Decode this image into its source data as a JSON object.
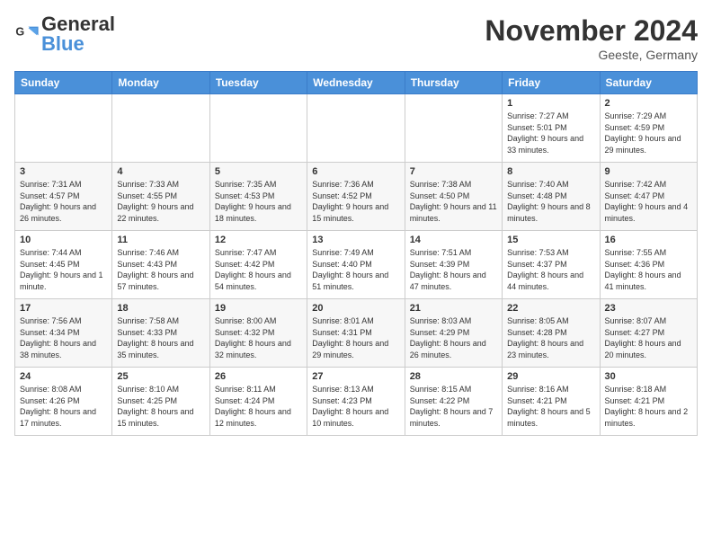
{
  "logo": {
    "text_general": "General",
    "text_blue": "Blue"
  },
  "header": {
    "month_year": "November 2024",
    "location": "Geeste, Germany"
  },
  "days_of_week": [
    "Sunday",
    "Monday",
    "Tuesday",
    "Wednesday",
    "Thursday",
    "Friday",
    "Saturday"
  ],
  "weeks": [
    [
      {
        "day": "",
        "info": ""
      },
      {
        "day": "",
        "info": ""
      },
      {
        "day": "",
        "info": ""
      },
      {
        "day": "",
        "info": ""
      },
      {
        "day": "",
        "info": ""
      },
      {
        "day": "1",
        "info": "Sunrise: 7:27 AM\nSunset: 5:01 PM\nDaylight: 9 hours and 33 minutes."
      },
      {
        "day": "2",
        "info": "Sunrise: 7:29 AM\nSunset: 4:59 PM\nDaylight: 9 hours and 29 minutes."
      }
    ],
    [
      {
        "day": "3",
        "info": "Sunrise: 7:31 AM\nSunset: 4:57 PM\nDaylight: 9 hours and 26 minutes."
      },
      {
        "day": "4",
        "info": "Sunrise: 7:33 AM\nSunset: 4:55 PM\nDaylight: 9 hours and 22 minutes."
      },
      {
        "day": "5",
        "info": "Sunrise: 7:35 AM\nSunset: 4:53 PM\nDaylight: 9 hours and 18 minutes."
      },
      {
        "day": "6",
        "info": "Sunrise: 7:36 AM\nSunset: 4:52 PM\nDaylight: 9 hours and 15 minutes."
      },
      {
        "day": "7",
        "info": "Sunrise: 7:38 AM\nSunset: 4:50 PM\nDaylight: 9 hours and 11 minutes."
      },
      {
        "day": "8",
        "info": "Sunrise: 7:40 AM\nSunset: 4:48 PM\nDaylight: 9 hours and 8 minutes."
      },
      {
        "day": "9",
        "info": "Sunrise: 7:42 AM\nSunset: 4:47 PM\nDaylight: 9 hours and 4 minutes."
      }
    ],
    [
      {
        "day": "10",
        "info": "Sunrise: 7:44 AM\nSunset: 4:45 PM\nDaylight: 9 hours and 1 minute."
      },
      {
        "day": "11",
        "info": "Sunrise: 7:46 AM\nSunset: 4:43 PM\nDaylight: 8 hours and 57 minutes."
      },
      {
        "day": "12",
        "info": "Sunrise: 7:47 AM\nSunset: 4:42 PM\nDaylight: 8 hours and 54 minutes."
      },
      {
        "day": "13",
        "info": "Sunrise: 7:49 AM\nSunset: 4:40 PM\nDaylight: 8 hours and 51 minutes."
      },
      {
        "day": "14",
        "info": "Sunrise: 7:51 AM\nSunset: 4:39 PM\nDaylight: 8 hours and 47 minutes."
      },
      {
        "day": "15",
        "info": "Sunrise: 7:53 AM\nSunset: 4:37 PM\nDaylight: 8 hours and 44 minutes."
      },
      {
        "day": "16",
        "info": "Sunrise: 7:55 AM\nSunset: 4:36 PM\nDaylight: 8 hours and 41 minutes."
      }
    ],
    [
      {
        "day": "17",
        "info": "Sunrise: 7:56 AM\nSunset: 4:34 PM\nDaylight: 8 hours and 38 minutes."
      },
      {
        "day": "18",
        "info": "Sunrise: 7:58 AM\nSunset: 4:33 PM\nDaylight: 8 hours and 35 minutes."
      },
      {
        "day": "19",
        "info": "Sunrise: 8:00 AM\nSunset: 4:32 PM\nDaylight: 8 hours and 32 minutes."
      },
      {
        "day": "20",
        "info": "Sunrise: 8:01 AM\nSunset: 4:31 PM\nDaylight: 8 hours and 29 minutes."
      },
      {
        "day": "21",
        "info": "Sunrise: 8:03 AM\nSunset: 4:29 PM\nDaylight: 8 hours and 26 minutes."
      },
      {
        "day": "22",
        "info": "Sunrise: 8:05 AM\nSunset: 4:28 PM\nDaylight: 8 hours and 23 minutes."
      },
      {
        "day": "23",
        "info": "Sunrise: 8:07 AM\nSunset: 4:27 PM\nDaylight: 8 hours and 20 minutes."
      }
    ],
    [
      {
        "day": "24",
        "info": "Sunrise: 8:08 AM\nSunset: 4:26 PM\nDaylight: 8 hours and 17 minutes."
      },
      {
        "day": "25",
        "info": "Sunrise: 8:10 AM\nSunset: 4:25 PM\nDaylight: 8 hours and 15 minutes."
      },
      {
        "day": "26",
        "info": "Sunrise: 8:11 AM\nSunset: 4:24 PM\nDaylight: 8 hours and 12 minutes."
      },
      {
        "day": "27",
        "info": "Sunrise: 8:13 AM\nSunset: 4:23 PM\nDaylight: 8 hours and 10 minutes."
      },
      {
        "day": "28",
        "info": "Sunrise: 8:15 AM\nSunset: 4:22 PM\nDaylight: 8 hours and 7 minutes."
      },
      {
        "day": "29",
        "info": "Sunrise: 8:16 AM\nSunset: 4:21 PM\nDaylight: 8 hours and 5 minutes."
      },
      {
        "day": "30",
        "info": "Sunrise: 8:18 AM\nSunset: 4:21 PM\nDaylight: 8 hours and 2 minutes."
      }
    ]
  ]
}
